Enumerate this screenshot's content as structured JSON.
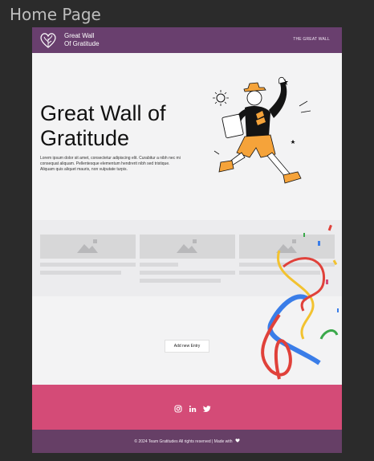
{
  "frame": {
    "title": "Home Page"
  },
  "header": {
    "brand_line1": "Great Wall",
    "brand_line2": "Of Gratitude",
    "nav_link": "THE GREAT WALL"
  },
  "hero": {
    "title_line1": "Great Wall of",
    "title_line2": "Gratitude",
    "body": "Lorem ipsum dolor sit amet, consectetur adipiscing elit. Curabitur a nibh nec mi consequat aliquam. Pellentesque elementum hendrerit nibh sed tristique. Aliquam quis aliquet mauris, non vulputate turpis."
  },
  "cards": [
    {
      "name": "placeholder-card-1"
    },
    {
      "name": "placeholder-card-2"
    },
    {
      "name": "placeholder-card-3"
    }
  ],
  "add_entry": {
    "label": "Add new Entry"
  },
  "social": {
    "icons": [
      "instagram-icon",
      "linkedin-icon",
      "twitter-icon"
    ]
  },
  "footer": {
    "text": "© 2024 Team Gratitudes All rights reserved | Made with"
  },
  "colors": {
    "header_bg": "#693f6e",
    "social_bg": "#d44b77",
    "footer_bg": "#663f66",
    "page_bg": "#f3f3f4"
  }
}
